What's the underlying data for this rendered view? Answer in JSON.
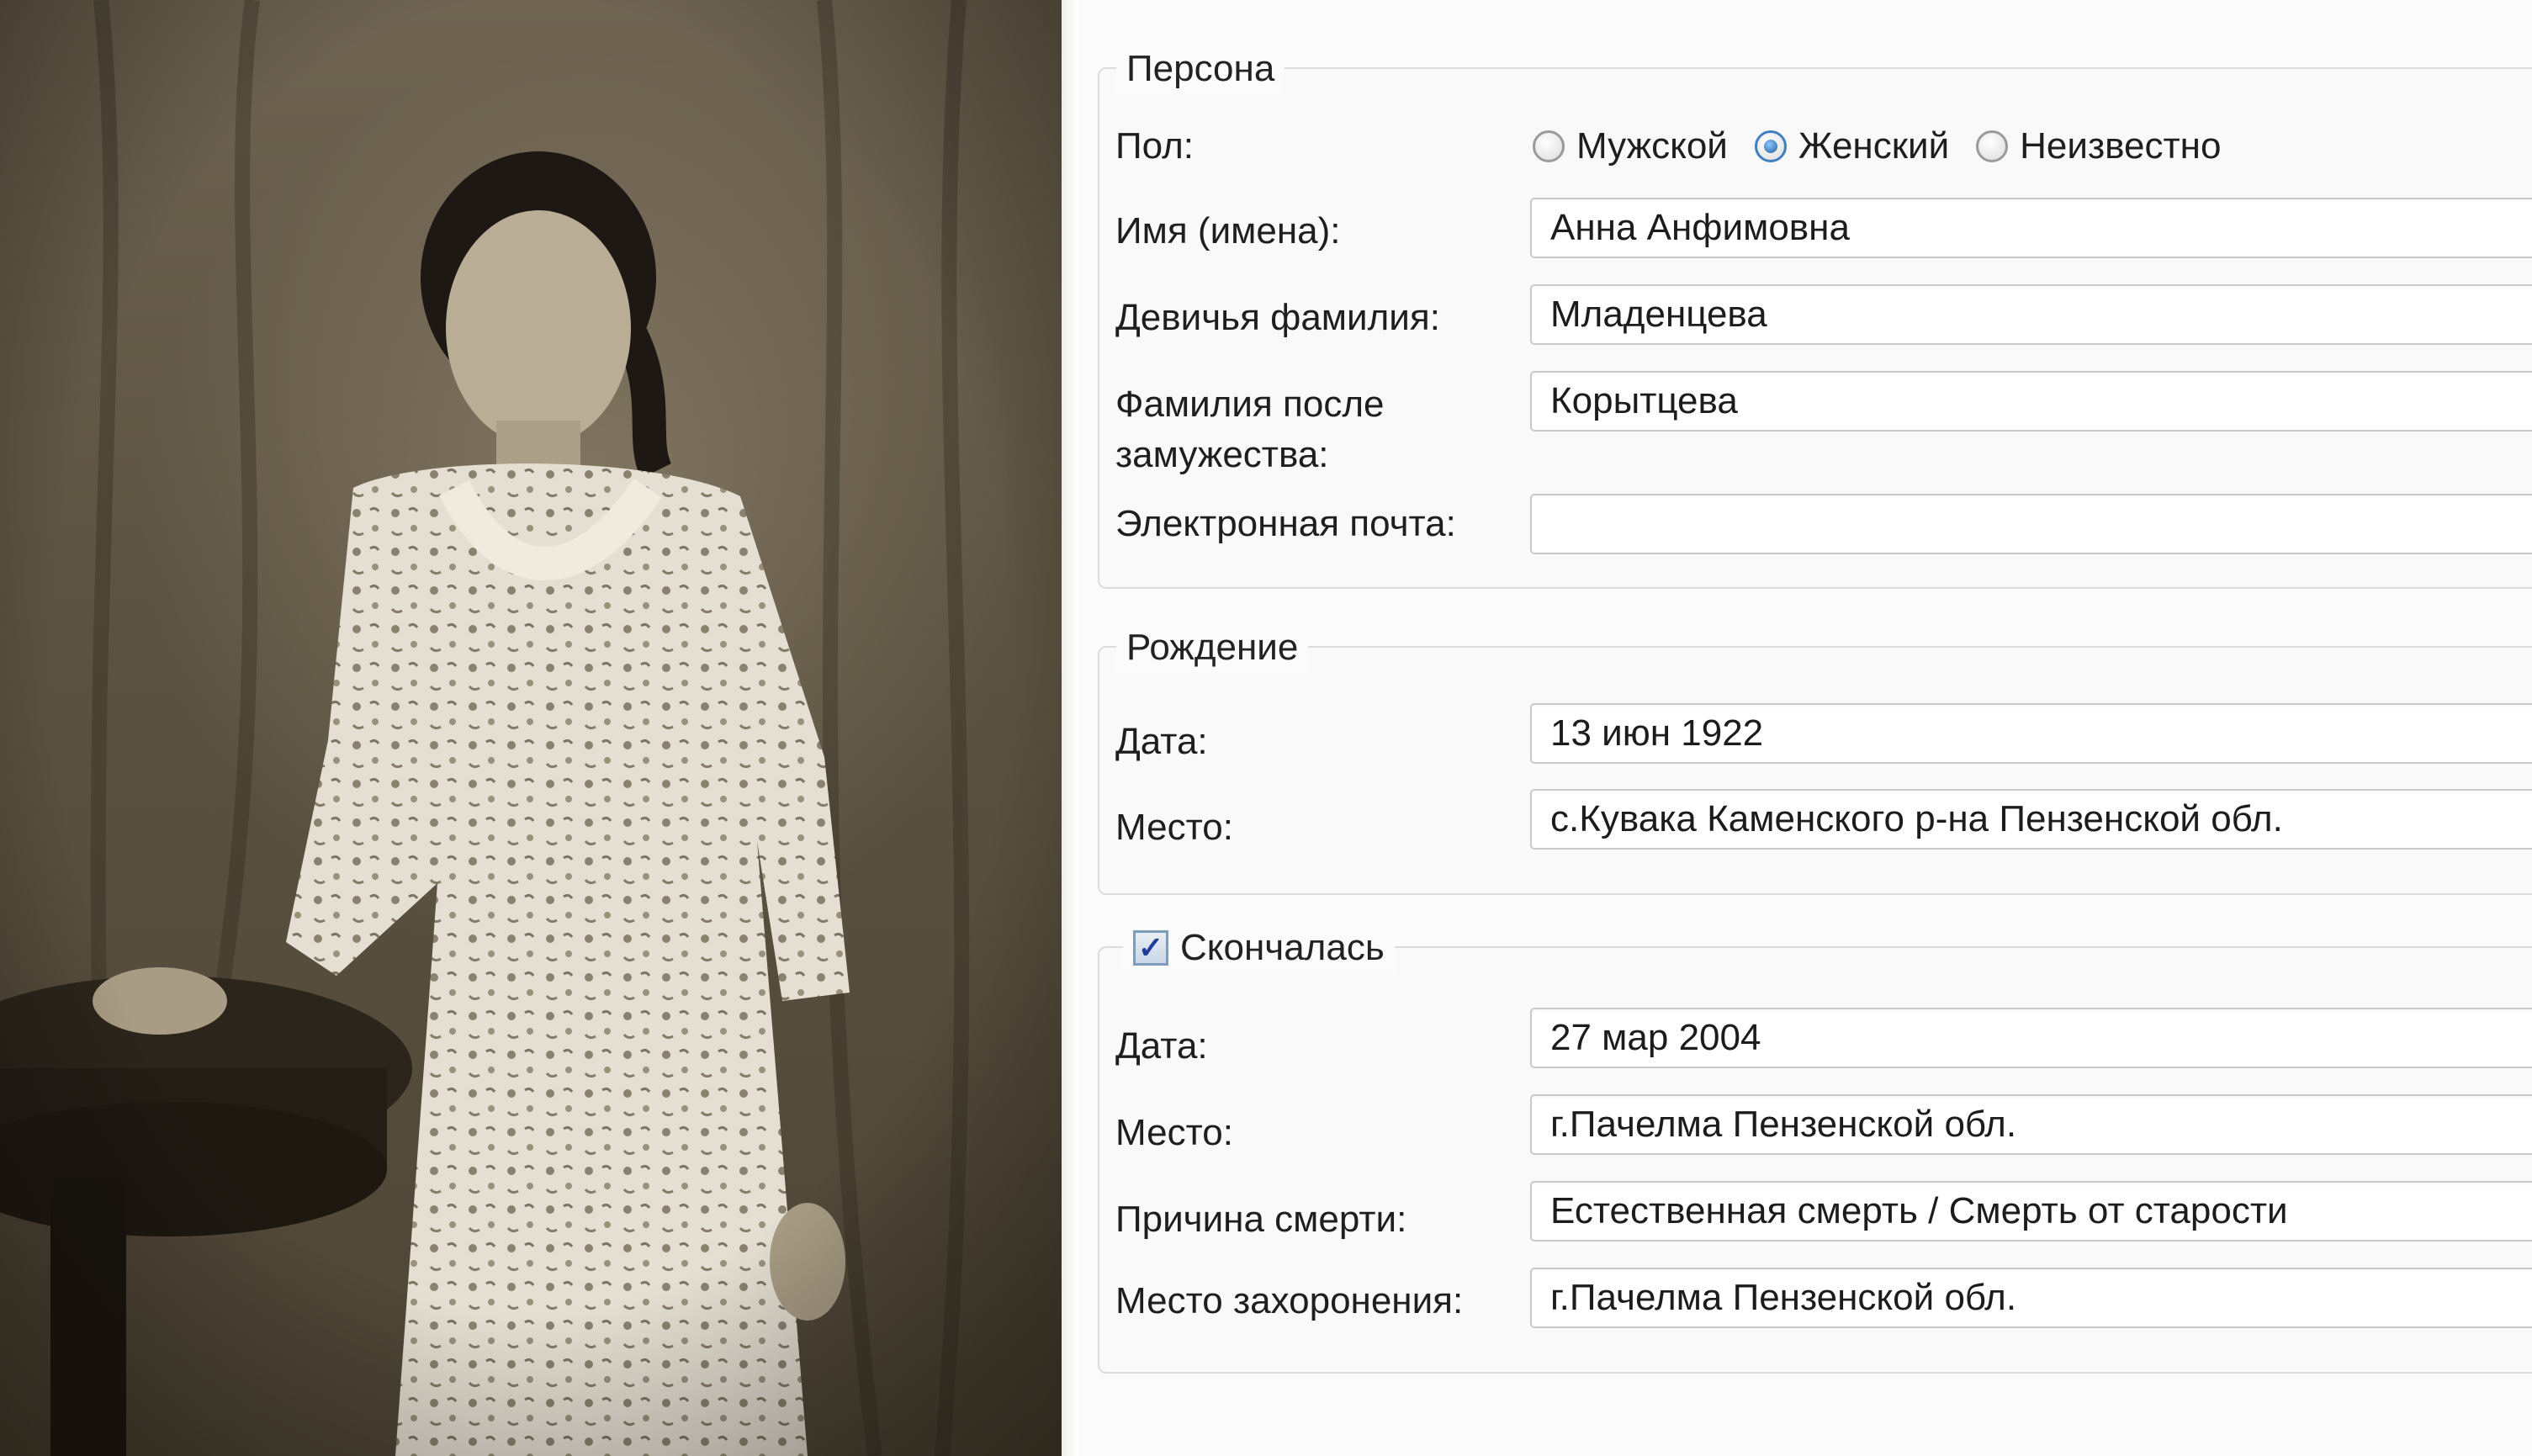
{
  "photo": {
    "subject": "woman-in-floral-dress-icon"
  },
  "person": {
    "legend": "Персона",
    "gender_label": "Пол:",
    "gender_options": [
      "Мужской",
      "Женский",
      "Неизвестно"
    ],
    "gender_selected": "Женский",
    "given_names_label": "Имя (имена):",
    "given_names": "Анна Анфимовна",
    "maiden_name_label": "Девичья фамилия:",
    "maiden_name": "Младенцева",
    "married_name_label_1": "Фамилия после",
    "married_name_label_2": "замужества:",
    "married_name": "Корытцева",
    "email_label": "Электронная почта:",
    "email": ""
  },
  "birth": {
    "legend": "Рождение",
    "date_label": "Дата:",
    "date": "13 июн 1922",
    "place_label": "Место:",
    "place": "с.Кувака Каменского р-на Пензенской обл."
  },
  "death": {
    "legend": "Скончалась",
    "checked": true,
    "date_label": "Дата:",
    "date": "27 мар 2004",
    "place_label": "Место:",
    "place": "г.Пачелма Пензенской обл.",
    "cause_label": "Причина смерти:",
    "cause": "Естественная смерть / Смерть от старости",
    "burial_label": "Место захоронения:",
    "burial": "г.Пачелма Пензенской обл."
  },
  "colors": {
    "accent": "#3d7fbf",
    "border": "#c9c9c9",
    "photo_tone": "#5d5342"
  }
}
